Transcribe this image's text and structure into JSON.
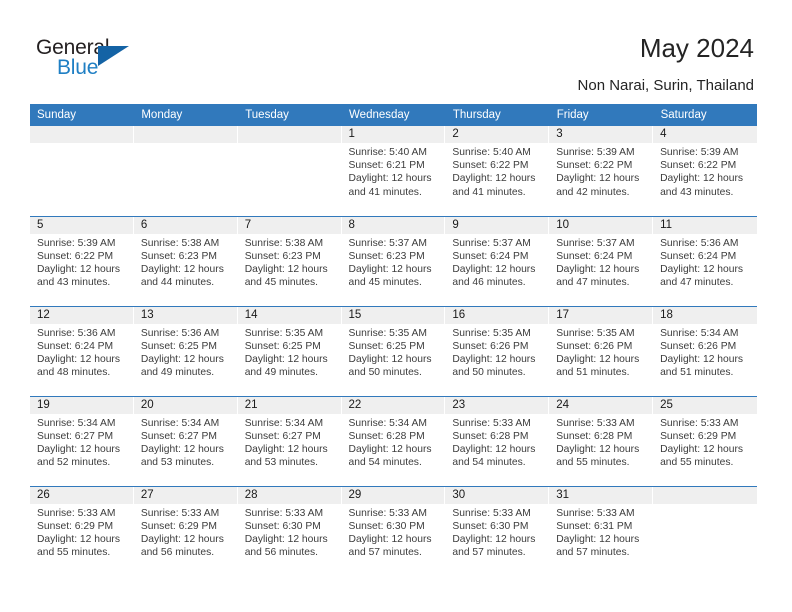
{
  "brand": {
    "logo_line1": "General",
    "logo_line2": "Blue",
    "logo_triangle_icon": "triangle-icon",
    "color_dark": "#231f20",
    "color_blue": "#1f7fc4"
  },
  "header": {
    "title": "May 2024",
    "subtitle": "Non Narai, Surin, Thailand"
  },
  "theme": {
    "header_bg": "#3179bc",
    "header_text": "#ffffff",
    "daynum_band_bg": "#efefef",
    "grid_line": "#3179bc",
    "body_text": "#3c3c3c"
  },
  "calendar": {
    "weekday_headers": [
      "Sunday",
      "Monday",
      "Tuesday",
      "Wednesday",
      "Thursday",
      "Friday",
      "Saturday"
    ],
    "labels": {
      "sunrise": "Sunrise:",
      "sunset": "Sunset:",
      "daylight": "Daylight:"
    },
    "weeks": [
      [
        {
          "day": "",
          "empty": true
        },
        {
          "day": "",
          "empty": true
        },
        {
          "day": "",
          "empty": true
        },
        {
          "day": "1",
          "sunrise": "Sunrise: 5:40 AM",
          "sunset": "Sunset: 6:21 PM",
          "daylight_line1": "Daylight: 12 hours",
          "daylight_line2": "and 41 minutes."
        },
        {
          "day": "2",
          "sunrise": "Sunrise: 5:40 AM",
          "sunset": "Sunset: 6:22 PM",
          "daylight_line1": "Daylight: 12 hours",
          "daylight_line2": "and 41 minutes."
        },
        {
          "day": "3",
          "sunrise": "Sunrise: 5:39 AM",
          "sunset": "Sunset: 6:22 PM",
          "daylight_line1": "Daylight: 12 hours",
          "daylight_line2": "and 42 minutes."
        },
        {
          "day": "4",
          "sunrise": "Sunrise: 5:39 AM",
          "sunset": "Sunset: 6:22 PM",
          "daylight_line1": "Daylight: 12 hours",
          "daylight_line2": "and 43 minutes."
        }
      ],
      [
        {
          "day": "5",
          "sunrise": "Sunrise: 5:39 AM",
          "sunset": "Sunset: 6:22 PM",
          "daylight_line1": "Daylight: 12 hours",
          "daylight_line2": "and 43 minutes."
        },
        {
          "day": "6",
          "sunrise": "Sunrise: 5:38 AM",
          "sunset": "Sunset: 6:23 PM",
          "daylight_line1": "Daylight: 12 hours",
          "daylight_line2": "and 44 minutes."
        },
        {
          "day": "7",
          "sunrise": "Sunrise: 5:38 AM",
          "sunset": "Sunset: 6:23 PM",
          "daylight_line1": "Daylight: 12 hours",
          "daylight_line2": "and 45 minutes."
        },
        {
          "day": "8",
          "sunrise": "Sunrise: 5:37 AM",
          "sunset": "Sunset: 6:23 PM",
          "daylight_line1": "Daylight: 12 hours",
          "daylight_line2": "and 45 minutes."
        },
        {
          "day": "9",
          "sunrise": "Sunrise: 5:37 AM",
          "sunset": "Sunset: 6:24 PM",
          "daylight_line1": "Daylight: 12 hours",
          "daylight_line2": "and 46 minutes."
        },
        {
          "day": "10",
          "sunrise": "Sunrise: 5:37 AM",
          "sunset": "Sunset: 6:24 PM",
          "daylight_line1": "Daylight: 12 hours",
          "daylight_line2": "and 47 minutes."
        },
        {
          "day": "11",
          "sunrise": "Sunrise: 5:36 AM",
          "sunset": "Sunset: 6:24 PM",
          "daylight_line1": "Daylight: 12 hours",
          "daylight_line2": "and 47 minutes."
        }
      ],
      [
        {
          "day": "12",
          "sunrise": "Sunrise: 5:36 AM",
          "sunset": "Sunset: 6:24 PM",
          "daylight_line1": "Daylight: 12 hours",
          "daylight_line2": "and 48 minutes."
        },
        {
          "day": "13",
          "sunrise": "Sunrise: 5:36 AM",
          "sunset": "Sunset: 6:25 PM",
          "daylight_line1": "Daylight: 12 hours",
          "daylight_line2": "and 49 minutes."
        },
        {
          "day": "14",
          "sunrise": "Sunrise: 5:35 AM",
          "sunset": "Sunset: 6:25 PM",
          "daylight_line1": "Daylight: 12 hours",
          "daylight_line2": "and 49 minutes."
        },
        {
          "day": "15",
          "sunrise": "Sunrise: 5:35 AM",
          "sunset": "Sunset: 6:25 PM",
          "daylight_line1": "Daylight: 12 hours",
          "daylight_line2": "and 50 minutes."
        },
        {
          "day": "16",
          "sunrise": "Sunrise: 5:35 AM",
          "sunset": "Sunset: 6:26 PM",
          "daylight_line1": "Daylight: 12 hours",
          "daylight_line2": "and 50 minutes."
        },
        {
          "day": "17",
          "sunrise": "Sunrise: 5:35 AM",
          "sunset": "Sunset: 6:26 PM",
          "daylight_line1": "Daylight: 12 hours",
          "daylight_line2": "and 51 minutes."
        },
        {
          "day": "18",
          "sunrise": "Sunrise: 5:34 AM",
          "sunset": "Sunset: 6:26 PM",
          "daylight_line1": "Daylight: 12 hours",
          "daylight_line2": "and 51 minutes."
        }
      ],
      [
        {
          "day": "19",
          "sunrise": "Sunrise: 5:34 AM",
          "sunset": "Sunset: 6:27 PM",
          "daylight_line1": "Daylight: 12 hours",
          "daylight_line2": "and 52 minutes."
        },
        {
          "day": "20",
          "sunrise": "Sunrise: 5:34 AM",
          "sunset": "Sunset: 6:27 PM",
          "daylight_line1": "Daylight: 12 hours",
          "daylight_line2": "and 53 minutes."
        },
        {
          "day": "21",
          "sunrise": "Sunrise: 5:34 AM",
          "sunset": "Sunset: 6:27 PM",
          "daylight_line1": "Daylight: 12 hours",
          "daylight_line2": "and 53 minutes."
        },
        {
          "day": "22",
          "sunrise": "Sunrise: 5:34 AM",
          "sunset": "Sunset: 6:28 PM",
          "daylight_line1": "Daylight: 12 hours",
          "daylight_line2": "and 54 minutes."
        },
        {
          "day": "23",
          "sunrise": "Sunrise: 5:33 AM",
          "sunset": "Sunset: 6:28 PM",
          "daylight_line1": "Daylight: 12 hours",
          "daylight_line2": "and 54 minutes."
        },
        {
          "day": "24",
          "sunrise": "Sunrise: 5:33 AM",
          "sunset": "Sunset: 6:28 PM",
          "daylight_line1": "Daylight: 12 hours",
          "daylight_line2": "and 55 minutes."
        },
        {
          "day": "25",
          "sunrise": "Sunrise: 5:33 AM",
          "sunset": "Sunset: 6:29 PM",
          "daylight_line1": "Daylight: 12 hours",
          "daylight_line2": "and 55 minutes."
        }
      ],
      [
        {
          "day": "26",
          "sunrise": "Sunrise: 5:33 AM",
          "sunset": "Sunset: 6:29 PM",
          "daylight_line1": "Daylight: 12 hours",
          "daylight_line2": "and 55 minutes."
        },
        {
          "day": "27",
          "sunrise": "Sunrise: 5:33 AM",
          "sunset": "Sunset: 6:29 PM",
          "daylight_line1": "Daylight: 12 hours",
          "daylight_line2": "and 56 minutes."
        },
        {
          "day": "28",
          "sunrise": "Sunrise: 5:33 AM",
          "sunset": "Sunset: 6:30 PM",
          "daylight_line1": "Daylight: 12 hours",
          "daylight_line2": "and 56 minutes."
        },
        {
          "day": "29",
          "sunrise": "Sunrise: 5:33 AM",
          "sunset": "Sunset: 6:30 PM",
          "daylight_line1": "Daylight: 12 hours",
          "daylight_line2": "and 57 minutes."
        },
        {
          "day": "30",
          "sunrise": "Sunrise: 5:33 AM",
          "sunset": "Sunset: 6:30 PM",
          "daylight_line1": "Daylight: 12 hours",
          "daylight_line2": "and 57 minutes."
        },
        {
          "day": "31",
          "sunrise": "Sunrise: 5:33 AM",
          "sunset": "Sunset: 6:31 PM",
          "daylight_line1": "Daylight: 12 hours",
          "daylight_line2": "and 57 minutes."
        },
        {
          "day": "",
          "empty": true
        }
      ]
    ]
  }
}
